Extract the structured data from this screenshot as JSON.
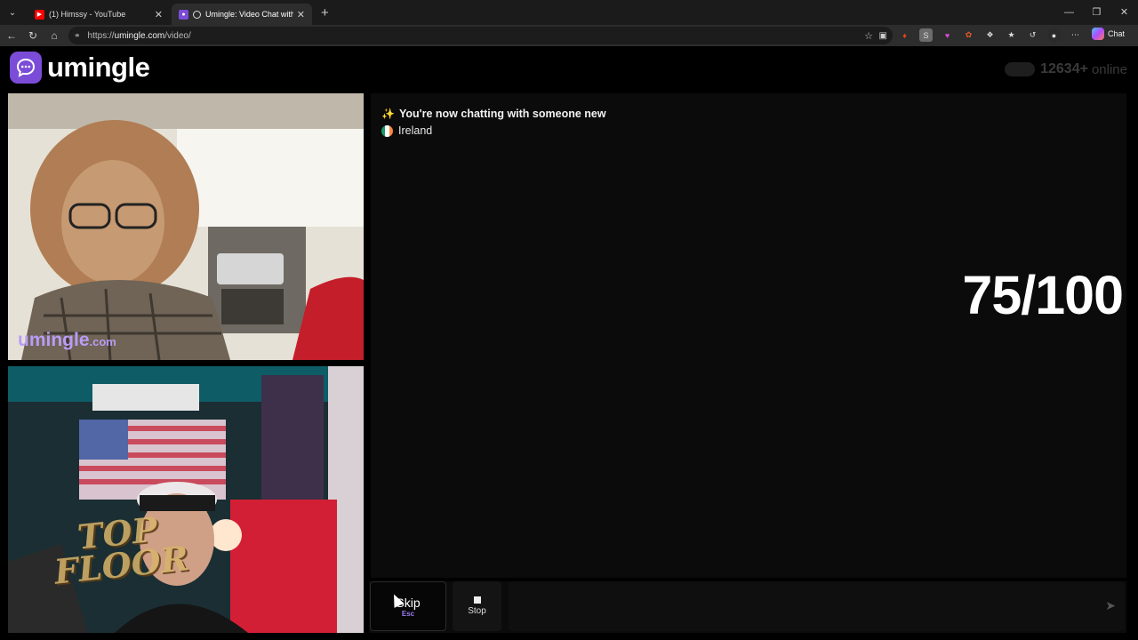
{
  "browser": {
    "tabs": [
      {
        "title": "(1) Himssy - YouTube",
        "favicon": "youtube-icon",
        "color": "#ff0000"
      },
      {
        "title": "Umingle: Video Chat with Stra",
        "favicon": "umingle-icon",
        "color": "#7b4cd8"
      }
    ],
    "url_prefix": "https://",
    "url_host": "umingle.com",
    "url_path": "/video/",
    "chat_label": "Chat"
  },
  "header": {
    "logo_text": "umingle",
    "online_count": "12634+",
    "online_word": "online"
  },
  "stranger_video": {
    "watermark_main": "umingle",
    "watermark_suffix": ".com"
  },
  "self_video": {
    "overlay_text_1": "TOP",
    "overlay_text_2": "FLOOR"
  },
  "chat": {
    "status_message": "You're now chatting with someone new",
    "country": "Ireland",
    "country_flag_colors": [
      "#169b62",
      "#ffffff",
      "#ff883e"
    ],
    "score": "75/100"
  },
  "controls": {
    "skip_label": "Skip",
    "skip_key": "Esc",
    "stop_label": "Stop",
    "message_placeholder": ""
  },
  "colors": {
    "brand": "#7b4cd8"
  }
}
